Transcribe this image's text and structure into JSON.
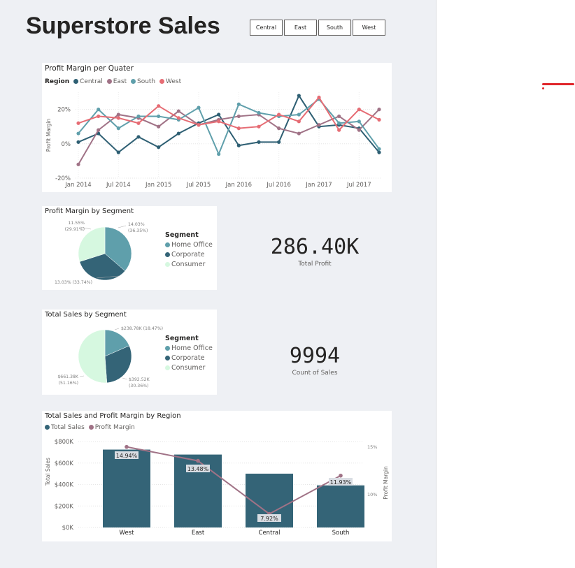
{
  "page": {
    "title": "Superstore Sales"
  },
  "slicer": {
    "options": [
      "Central",
      "East",
      "South",
      "West"
    ]
  },
  "colors": {
    "Central": "#2e5f73",
    "East": "#a07286",
    "South": "#5f9fab",
    "West": "#e66c74",
    "HomeOffice": "#5f9fab",
    "Corporate": "#346477",
    "Consumer": "#d6f8e0",
    "Bar": "#346477",
    "Line": "#a07286"
  },
  "kpis": [
    {
      "value": "286.40K",
      "label": "Total Profit"
    },
    {
      "value": "9994",
      "label": "Count of Sales"
    }
  ],
  "chart_data": [
    {
      "type": "line",
      "title": "Profit Margin per Quater",
      "legend_title": "Region",
      "ylabel": "Profit Margin",
      "yticks": [
        "20%",
        "0%",
        "-20%"
      ],
      "xticks": [
        "Jan 2014",
        "Jul 2014",
        "Jan 2015",
        "Jul 2015",
        "Jan 2016",
        "Jul 2016",
        "Jan 2017",
        "Jul 2017"
      ],
      "ylim": [
        -20,
        30
      ],
      "x": [
        "2014Q1",
        "2014Q2",
        "2014Q3",
        "2014Q4",
        "2015Q1",
        "2015Q2",
        "2015Q3",
        "2015Q4",
        "2016Q1",
        "2016Q2",
        "2016Q3",
        "2016Q4",
        "2017Q1",
        "2017Q2",
        "2017Q3",
        "2017Q4"
      ],
      "series": [
        {
          "name": "Central",
          "values": [
            1,
            6,
            -5,
            4,
            -2,
            6,
            12,
            17,
            -1,
            1,
            1,
            28,
            10,
            11,
            9,
            -5
          ]
        },
        {
          "name": "East",
          "values": [
            -12,
            8,
            17,
            15,
            10,
            19,
            11,
            14,
            16,
            17,
            9,
            6,
            11,
            16,
            8,
            20
          ]
        },
        {
          "name": "South",
          "values": [
            6,
            20,
            9,
            16,
            16,
            14,
            21,
            -6,
            23,
            18,
            16,
            17,
            26,
            12,
            13,
            -3
          ]
        },
        {
          "name": "West",
          "values": [
            12,
            16,
            15,
            12,
            22,
            15,
            11,
            13,
            9,
            10,
            17,
            13,
            27,
            8,
            20,
            14
          ]
        }
      ]
    },
    {
      "type": "pie",
      "title": "Profit Margin by Segment",
      "legend_title": "Segment",
      "labels": [
        "Home Office",
        "Corporate",
        "Consumer"
      ],
      "values": [
        36.35,
        33.74,
        29.91
      ],
      "data_labels": [
        [
          "14.03%",
          "(36.35%)"
        ],
        [
          "13.03% (33.74%)"
        ],
        [
          "11.55%",
          "(29.91%)"
        ]
      ]
    },
    {
      "type": "pie",
      "title": "Total Sales by Segment",
      "legend_title": "Segment",
      "labels": [
        "Home Office",
        "Corporate",
        "Consumer"
      ],
      "values": [
        18.47,
        30.36,
        51.16
      ],
      "data_labels": [
        [
          "$238.78K (18.47%)"
        ],
        [
          "$392.52K",
          "(30.36%)"
        ],
        [
          "$661.38K",
          "(51.16%)"
        ]
      ]
    },
    {
      "type": "bar",
      "title": "Total Sales and Profit Margin by Region",
      "legend": [
        "Total Sales",
        "Profit Margin"
      ],
      "categories": [
        "West",
        "East",
        "Central",
        "South"
      ],
      "values": [
        725000,
        679000,
        501000,
        392000
      ],
      "line_values": [
        14.94,
        13.48,
        7.92,
        11.93
      ],
      "line_labels": [
        "14.94%",
        "13.48%",
        "7.92%",
        "11.93%"
      ],
      "ylabel": "Total Sales",
      "y2label": "Profit Margin",
      "ylim": [
        0,
        800000
      ],
      "y2lim": [
        6.5,
        15.5
      ],
      "yticks": [
        "$800K",
        "$600K",
        "$400K",
        "$200K",
        "$0K"
      ],
      "y2ticks": [
        "15%",
        "10%"
      ]
    }
  ]
}
